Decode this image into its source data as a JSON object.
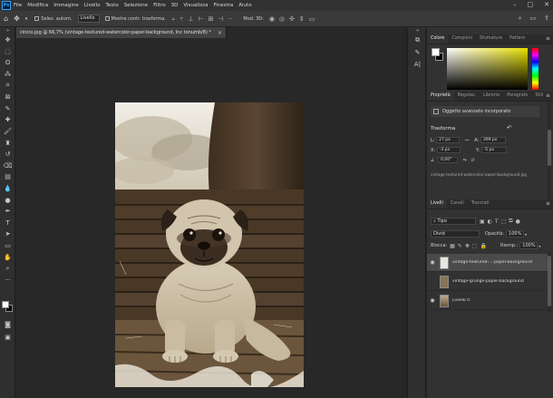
{
  "menubar": {
    "app_logo": "Ps",
    "items": [
      "File",
      "Modifica",
      "Immagine",
      "Livello",
      "Testo",
      "Selezione",
      "Filtro",
      "3D",
      "Visualizza",
      "Finestra",
      "Aiuto"
    ],
    "window_controls": [
      "–",
      "□",
      "✕"
    ]
  },
  "options_bar": {
    "auto_select_label": "Selez. autom.",
    "auto_select_target": "Livello",
    "transform_controls_label": "Mostra contr. trasforma.",
    "more_label": "···",
    "mode_3d_label": "Mod. 3D:"
  },
  "document_tab": {
    "title": "cincio.jpg @ 66,7% (vintage-textured-watercolor-paper-background, Inc tonumb/8) *",
    "close": "×"
  },
  "color_panel": {
    "tabs": [
      "Colore",
      "Campioni",
      "Sfumature",
      "Pattern"
    ],
    "active_tab": 0,
    "foreground": "#ffffff",
    "background": "#000000",
    "spectrum_color": "#e8e000"
  },
  "properties_panel": {
    "tabs": [
      "Proprietà",
      "Regolaz.",
      "Librerie",
      "Paragrafo",
      "Stili"
    ],
    "active_tab": 0,
    "object_type": "Oggetto avanzato incorporato",
    "section_title": "Trasforma",
    "w_label": "L:",
    "w_value": "27 px",
    "h_label": "A:",
    "h_value": "399 px",
    "x_label": "X:",
    "x_value": "-3 px",
    "y_label": "Y:",
    "y_value": "-5 px",
    "angle_label": "∠",
    "angle_value": "0,00°",
    "file_name": "vintage-textured-watercolor-paper-background.jpg"
  },
  "layers_panel": {
    "tabs": [
      "Livelli",
      "Canali",
      "Tracciati"
    ],
    "active_tab": 0,
    "filter_label": "Tipo",
    "blend_mode": "Divid",
    "opacity_label": "Opacità:",
    "opacity_value": "100%",
    "lock_label": "Blocca:",
    "fill_label": "Riemp.:",
    "fill_value": "100%",
    "layers": [
      {
        "name": "vintage-textured-...-paper-background",
        "visible": true,
        "selected": true,
        "thumb": "white"
      },
      {
        "name": "vintage-grunge-paper-background",
        "visible": false,
        "selected": false,
        "thumb": "paper"
      },
      {
        "name": "Livello 0",
        "visible": true,
        "selected": false,
        "thumb": "pug"
      }
    ]
  },
  "colors": {
    "accent": "#31a8ff",
    "sepia_dark": "#3b2c1d",
    "sepia_light": "#d9cdb8"
  }
}
